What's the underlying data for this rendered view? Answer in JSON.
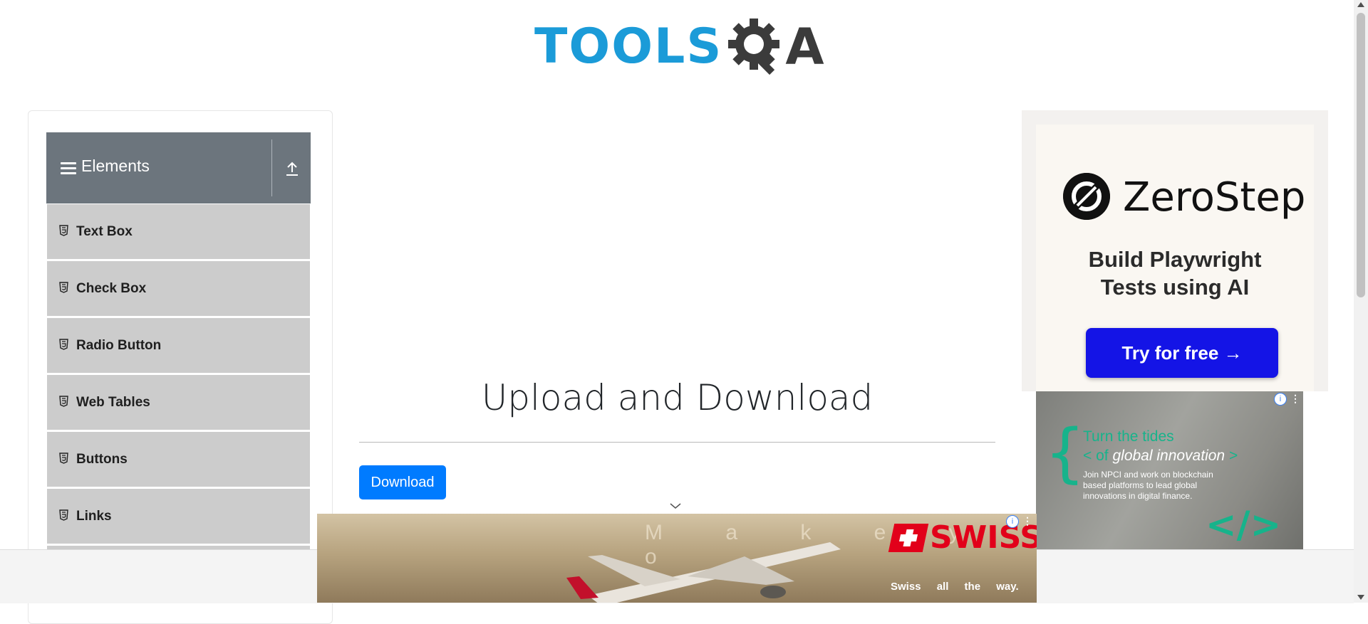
{
  "header": {
    "logo_tools": "TOOLS",
    "logo_qa": "A",
    "brand_color": "#1b9bd8"
  },
  "sidebar": {
    "group_title": "Elements",
    "group_icons": [
      "hamburger-icon",
      "upload-icon"
    ],
    "items": [
      {
        "label": "Text Box",
        "icon": "html5-icon"
      },
      {
        "label": "Check Box",
        "icon": "html5-icon"
      },
      {
        "label": "Radio Button",
        "icon": "html5-icon"
      },
      {
        "label": "Web Tables",
        "icon": "html5-icon"
      },
      {
        "label": "Buttons",
        "icon": "html5-icon"
      },
      {
        "label": "Links",
        "icon": "html5-icon"
      }
    ]
  },
  "main": {
    "title": "Upload and Download",
    "download_label": "Download",
    "accent": "#007bff"
  },
  "ads": {
    "zerostep": {
      "name": "ZeroStep",
      "tagline_1": "Build Playwright",
      "tagline_2": "Tests using AI",
      "cta": "Try for free →",
      "cta_color": "#1414e6"
    },
    "npci": {
      "headline_1": "Turn the tides",
      "headline_2_prefix": "< of",
      "headline_2_main": "global innovation",
      "headline_2_suffix": ">",
      "body": "Join NPCI and work on blockchain based platforms to lead global innovations in digital finance.",
      "badge": "i"
    },
    "swiss": {
      "overlay_text": "M a k e y o",
      "logo": "SWISS",
      "slogan": "Swiss all the way.",
      "badge": "i"
    }
  }
}
